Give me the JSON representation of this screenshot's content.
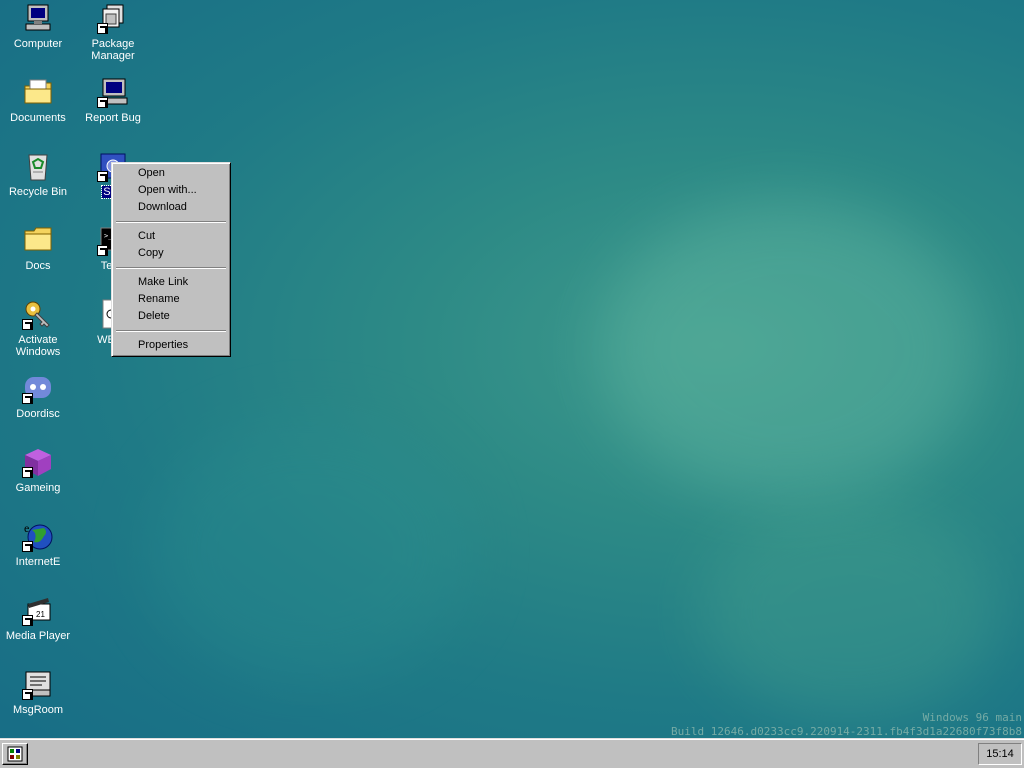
{
  "desktop_icons": [
    {
      "label": "Computer",
      "icon": "computer-icon"
    },
    {
      "label": "Package Manager",
      "icon": "package-manager-icon"
    },
    {
      "label": "Documents",
      "icon": "documents-folder-icon"
    },
    {
      "label": "Report Bug",
      "icon": "report-bug-icon"
    },
    {
      "label": "Recycle Bin",
      "icon": "recycle-bin-icon"
    },
    {
      "label": "Sett",
      "icon": "settings-icon"
    },
    {
      "label": "Docs",
      "icon": "folder-icon"
    },
    {
      "label": "Term",
      "icon": "terminal-icon"
    },
    {
      "label": "Activate Windows",
      "icon": "activate-key-icon"
    },
    {
      "label": "WELC",
      "icon": "welcome-icon"
    },
    {
      "label": "Doordisc",
      "icon": "doordisc-icon"
    },
    {
      "label": "Gameing",
      "icon": "gameing-cube-icon"
    },
    {
      "label": "InternetE",
      "icon": "internet-globe-icon"
    },
    {
      "label": "Media Player",
      "icon": "media-player-icon"
    },
    {
      "label": "MsgRoom",
      "icon": "msgroom-icon"
    }
  ],
  "context_menu": {
    "items": [
      "Open",
      "Open with...",
      "Download",
      "Cut",
      "Copy",
      "Make Link",
      "Rename",
      "Delete",
      "Properties"
    ]
  },
  "watermark": {
    "line1": "Windows 96 main",
    "line2": "Build 12646.d0233cc9.220914-2311.fb4f3d1a22680f73f8b8"
  },
  "taskbar": {
    "start_icon": "start-icon",
    "clock": "15:14"
  },
  "colors": {
    "desktop": "#1f7a86",
    "selection": "#000080",
    "menu_face": "#c0c0c0"
  }
}
